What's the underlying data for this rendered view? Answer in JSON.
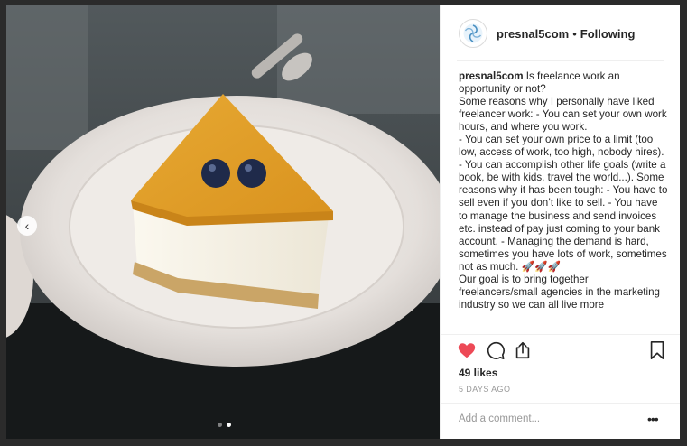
{
  "post": {
    "username": "presnal5com",
    "separator": "•",
    "follow_state": "Following",
    "caption_lines": [
      "Is freelance work an opportunity or not?",
      "Some reasons why I personally have liked freelancer work: - You can set your own work hours, and where you work.",
      "- You can set your own price to a limit (too low, access of work, too high, nobody hires).",
      "- You can accomplish other life goals (write a book, be with kids, travel the world...). Some reasons why it has been tough: - You have to sell even if you don’t like to sell. - You have to manage the business and send invoices etc. instead of pay just coming to your bank account. - Managing the demand is hard, sometimes you have lots of work, sometimes not as much. 🚀🚀🚀",
      "Our goal is to bring together freelancers/small agencies in the marketing industry so we can all live more"
    ],
    "likes": "49 likes",
    "date": "5 DAYS AGO",
    "comment_placeholder": "Add a comment...",
    "more_label": "•••",
    "prev_arrow": "‹"
  },
  "carousel": {
    "total_slides": 2,
    "active_slide": 2
  },
  "icons": {
    "avatar": "swirl-logo-icon",
    "like": "heart-icon",
    "comment": "comment-bubble-icon",
    "share": "share-icon",
    "save": "bookmark-icon",
    "prev": "chevron-left-icon"
  },
  "colors": {
    "like_active": "#ed4956",
    "text": "#262626",
    "muted": "#999999",
    "divider": "#efefef"
  }
}
